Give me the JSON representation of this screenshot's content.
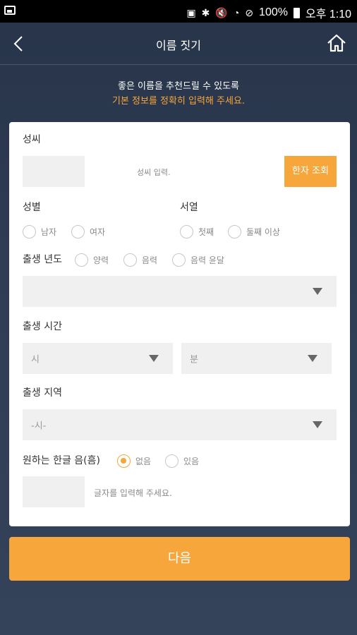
{
  "status_bar": {
    "battery": "100%",
    "time": "오후 1:10"
  },
  "app_bar": {
    "title": "이름 짓기"
  },
  "intro": {
    "line1": "좋은 이름을 추천드릴 수 있도록",
    "line2": "기본 정보를 정확히 입력해 주세요."
  },
  "form": {
    "surname": {
      "label": "성씨",
      "hint": "성씨 입력.",
      "hanja_button": "한자 조회"
    },
    "gender": {
      "label": "성별",
      "options": [
        "남자",
        "여자"
      ]
    },
    "order": {
      "label": "서열",
      "options": [
        "첫째",
        "둘째 이상"
      ]
    },
    "birth_year": {
      "label": "출생 년도",
      "options": [
        "양력",
        "음력",
        "음력 윤달"
      ],
      "select_value": ""
    },
    "birth_time": {
      "label": "출생 시간",
      "hour_placeholder": "시",
      "minute_placeholder": "분"
    },
    "birth_region": {
      "label": "출생 지역",
      "select_value": "-시-"
    },
    "hangul_sound": {
      "label": "원하는 한글 음(흠)",
      "options": [
        "없음",
        "있음"
      ],
      "selected": "없음",
      "hint": "글자를 입력해 주세요."
    }
  },
  "next_button": "다음",
  "colors": {
    "accent": "#f6a63b",
    "background": "#2e3c54"
  }
}
